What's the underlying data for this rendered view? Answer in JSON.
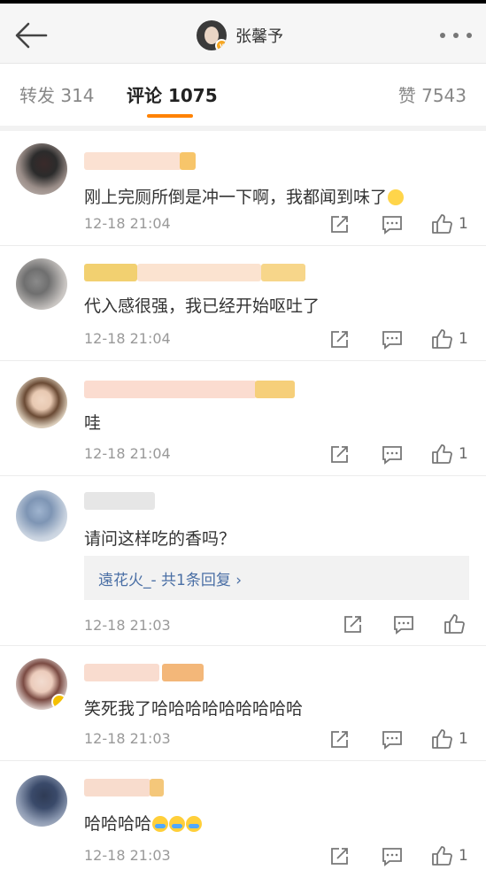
{
  "header": {
    "title": "张馨予"
  },
  "tabs": {
    "forward": "转发 314",
    "comment": "评论 1075",
    "like": "赞 7543"
  },
  "comments": [
    {
      "text": "刚上完厕所倒是冲一下啊，我都闻到味了",
      "time": "12-18 21:04",
      "likes": "1"
    },
    {
      "text": "代入感很强，我已经开始呕吐了",
      "time": "12-18 21:04",
      "likes": "1"
    },
    {
      "text": "哇",
      "time": "12-18 21:04",
      "likes": "1"
    },
    {
      "text": "请问这样吃的香吗？",
      "time": "12-18 21:03",
      "likes": "",
      "reply": "遠花火_- 共1条回复 ›"
    },
    {
      "text": "笑死我了哈哈哈哈哈哈哈哈哈",
      "time": "12-18 21:03",
      "likes": "1"
    },
    {
      "text": "哈哈哈哈",
      "time": "12-18 21:03",
      "likes": "1"
    }
  ],
  "colors": {
    "accent": "#ff8200",
    "reply_link": "#4a6fa5"
  }
}
